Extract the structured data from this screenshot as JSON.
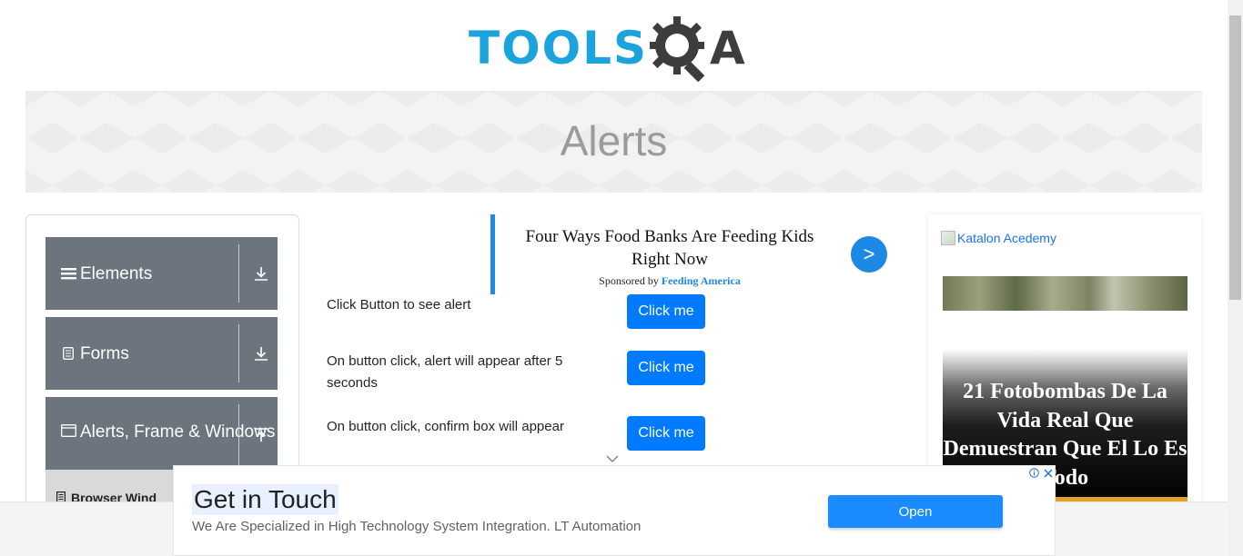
{
  "header": {
    "logo_tools": "TOOLS",
    "logo_a": "A"
  },
  "banner": {
    "title": "Alerts"
  },
  "sidebar": {
    "groups": [
      {
        "label": "Elements",
        "icon": "hamburger-icon"
      },
      {
        "label": "Forms",
        "icon": "document-icon"
      },
      {
        "label": "Alerts, Frame & Windows",
        "icon": "window-icon"
      }
    ],
    "submenu_item": "Browser Wind"
  },
  "ad_mid": {
    "headline": "Four Ways Food Banks Are Feeding Kids Right Now",
    "sponsor_prefix": "Sponsored by",
    "sponsor_name": "Feeding America",
    "go_label": ">"
  },
  "rows": [
    {
      "text": "Click Button to see alert",
      "button": "Click me"
    },
    {
      "text": "On button click, alert will appear after 5 seconds",
      "button": "Click me"
    },
    {
      "text": "On button click, confirm box will appear",
      "button": "Click me"
    }
  ],
  "ad_right": {
    "image_alt": "Katalon Acedemy",
    "headline": "21 Fotobombas De La Vida Real Que Demuestran Que El Lo Es Todo"
  },
  "bottom_ad": {
    "title": "Get in Touch",
    "subtitle": "We Are Specialized in High Technology System Integration. LT Automation",
    "open_label": "Open"
  },
  "colors": {
    "primary": "#007bff",
    "sidebar": "#6c757d",
    "logo_blue": "#1aa3dc"
  }
}
